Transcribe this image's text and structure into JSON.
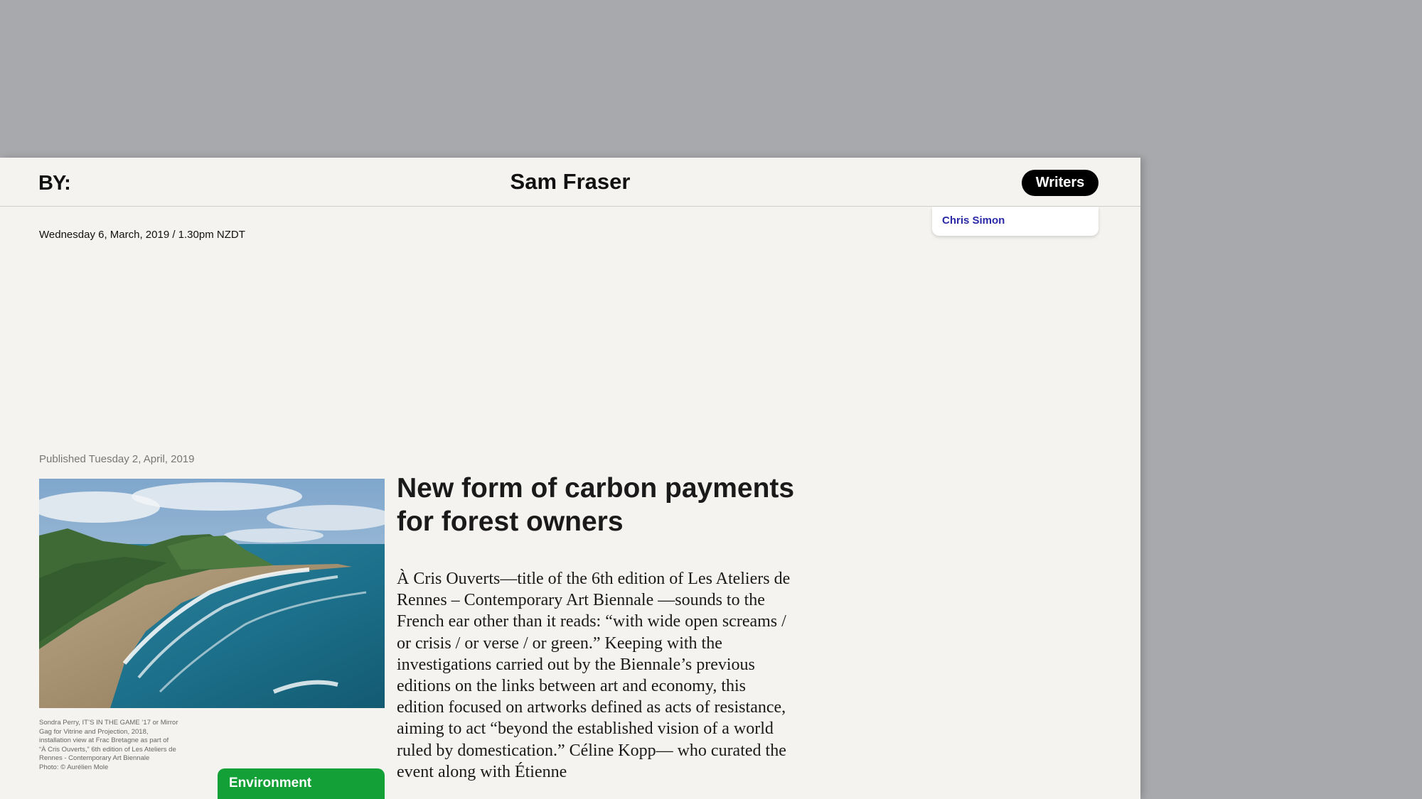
{
  "header": {
    "logo": "BY:",
    "title": "Sam Fraser",
    "writers_button": "Writers"
  },
  "writers_menu": {
    "items": [
      "Chris Simon"
    ]
  },
  "date_line": "Wednesday 6, March, 2019 / 1.30pm NZDT",
  "article": {
    "published": "Published Tuesday 2, April, 2019",
    "headline_line1": "New form of carbon payments",
    "headline_line2": "for forest owners",
    "body": "À Cris Ouverts—title of the 6th edition of Les Ateliers de Rennes – Contemporary Art Biennale —sounds to the French ear other than it reads: “with wide open screams / or crisis / or verse / or green.” Keeping with the investigations carried out by the Biennale’s previous editions on the links between art and economy, this edition focused on artworks defined as acts of resistance, aiming to act “beyond the established vision of a world ruled by domestication.” Céline Kopp— who curated the event along with Étienne",
    "caption": [
      "Sondra Perry, IT’S IN THE GAME ’17 or Mirror",
      "Gag for Vitrine and Projection, 2018,",
      "installation  view at Frac Bretagne as part of",
      "“À Cris Ouverts,” 6th edition of Les Ateliers de",
      "Rennes - Contemporary Art Biennale",
      "Photo: © Aurélien Mole"
    ],
    "tag": "Environment"
  },
  "colors": {
    "background": "#a8a9ac",
    "page": "#f4f3ef",
    "tag_green": "#12a037",
    "link_blue": "#2a2aa8"
  }
}
